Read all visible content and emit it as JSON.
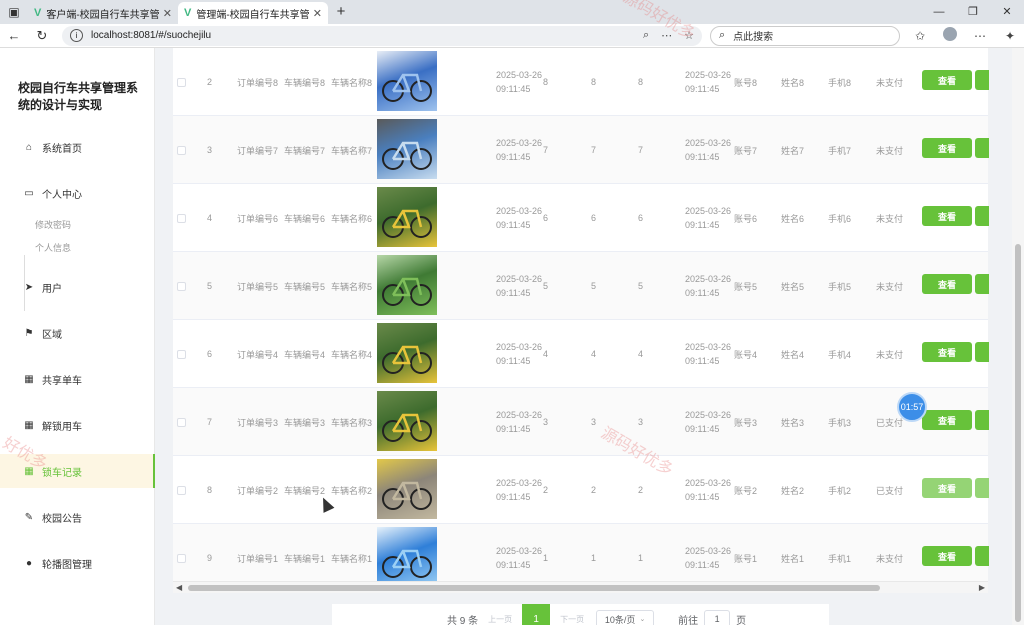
{
  "browser": {
    "tabs": [
      {
        "title": "客户端-校园自行车共享管理系统的",
        "active": false
      },
      {
        "title": "管理端-校园自行车共享管理系统的",
        "active": true
      }
    ],
    "url": "localhost:8081/#/suochejilu",
    "search_placeholder": "点此搜索"
  },
  "sidebar": {
    "brand": "校园自行车共享管理系统的设计与实现",
    "items": [
      {
        "label": "系统首页",
        "icon": "home-icon"
      },
      {
        "label": "个人中心",
        "icon": "window-icon"
      },
      {
        "label": "用户",
        "icon": "send-icon"
      },
      {
        "label": "区域",
        "icon": "flag-icon"
      },
      {
        "label": "共享单车",
        "icon": "grid-icon"
      },
      {
        "label": "解锁用车",
        "icon": "grid-icon"
      },
      {
        "label": "锁车记录",
        "icon": "grid-icon",
        "active": true
      },
      {
        "label": "校园公告",
        "icon": "pen-icon"
      },
      {
        "label": "轮播图管理",
        "icon": "map-pin-icon"
      }
    ],
    "sub_items": [
      "修改密码",
      "个人信息"
    ]
  },
  "table": {
    "rows": [
      {
        "idx": "2",
        "order": "订单编号8",
        "bikeno": "车辆编号8",
        "bikename": "车辆名称8",
        "t1": "2025-03-26",
        "t2": "09:11:45",
        "a": "8",
        "b": "8",
        "c": "8",
        "d1": "2025-03-26",
        "d2": "09:11:45",
        "acct": "账号8",
        "name": "姓名8",
        "phone": "手机8",
        "status": "未支付",
        "img": "blue"
      },
      {
        "idx": "3",
        "order": "订单编号7",
        "bikeno": "车辆编号7",
        "bikename": "车辆名称7",
        "t1": "2025-03-26",
        "t2": "09:11:45",
        "a": "7",
        "b": "7",
        "c": "7",
        "d1": "2025-03-26",
        "d2": "09:11:45",
        "acct": "账号7",
        "name": "姓名7",
        "phone": "手机7",
        "status": "未支付",
        "img": "lightblue"
      },
      {
        "idx": "4",
        "order": "订单编号6",
        "bikeno": "车辆编号6",
        "bikename": "车辆名称6",
        "t1": "2025-03-26",
        "t2": "09:11:45",
        "a": "6",
        "b": "6",
        "c": "6",
        "d1": "2025-03-26",
        "d2": "09:11:45",
        "acct": "账号6",
        "name": "姓名6",
        "phone": "手机6",
        "status": "未支付",
        "img": "yellow"
      },
      {
        "idx": "5",
        "order": "订单编号5",
        "bikeno": "车辆编号5",
        "bikename": "车辆名称5",
        "t1": "2025-03-26",
        "t2": "09:11:45",
        "a": "5",
        "b": "5",
        "c": "5",
        "d1": "2025-03-26",
        "d2": "09:11:45",
        "acct": "账号5",
        "name": "姓名5",
        "phone": "手机5",
        "status": "未支付",
        "img": "green"
      },
      {
        "idx": "6",
        "order": "订单编号4",
        "bikeno": "车辆编号4",
        "bikename": "车辆名称4",
        "t1": "2025-03-26",
        "t2": "09:11:45",
        "a": "4",
        "b": "4",
        "c": "4",
        "d1": "2025-03-26",
        "d2": "09:11:45",
        "acct": "账号4",
        "name": "姓名4",
        "phone": "手机4",
        "status": "未支付",
        "img": "yellow"
      },
      {
        "idx": "7",
        "order": "订单编号3",
        "bikeno": "车辆编号3",
        "bikename": "车辆名称3",
        "t1": "2025-03-26",
        "t2": "09:11:45",
        "a": "3",
        "b": "3",
        "c": "3",
        "d1": "2025-03-26",
        "d2": "09:11:45",
        "acct": "账号3",
        "name": "姓名3",
        "phone": "手机3",
        "status": "已支付",
        "img": "yellow"
      },
      {
        "idx": "8",
        "order": "订单编号2",
        "bikeno": "车辆编号2",
        "bikename": "车辆名称2",
        "t1": "2025-03-26",
        "t2": "09:11:45",
        "a": "2",
        "b": "2",
        "c": "2",
        "d1": "2025-03-26",
        "d2": "09:11:45",
        "acct": "账号2",
        "name": "姓名2",
        "phone": "手机2",
        "status": "已支付",
        "img": "tan"
      },
      {
        "idx": "9",
        "order": "订单编号1",
        "bikeno": "车辆编号1",
        "bikename": "车辆名称1",
        "t1": "2025-03-26",
        "t2": "09:11:45",
        "a": "1",
        "b": "1",
        "c": "1",
        "d1": "2025-03-26",
        "d2": "09:11:45",
        "acct": "账号1",
        "name": "姓名1",
        "phone": "手机1",
        "status": "未支付",
        "img": "sky"
      }
    ],
    "view_label": "查看"
  },
  "pager": {
    "total": "共 9 条",
    "prev": "上一页",
    "current": "1",
    "next": "下一页",
    "size": "10条/页",
    "goto": "前往",
    "goto_value": "1",
    "page_suffix": "页"
  },
  "timer": "01:57",
  "watermark": [
    "源码好优多",
    "好优多"
  ],
  "colors": {
    "accent": "#67c23a",
    "timer": "#3c8ee8"
  }
}
